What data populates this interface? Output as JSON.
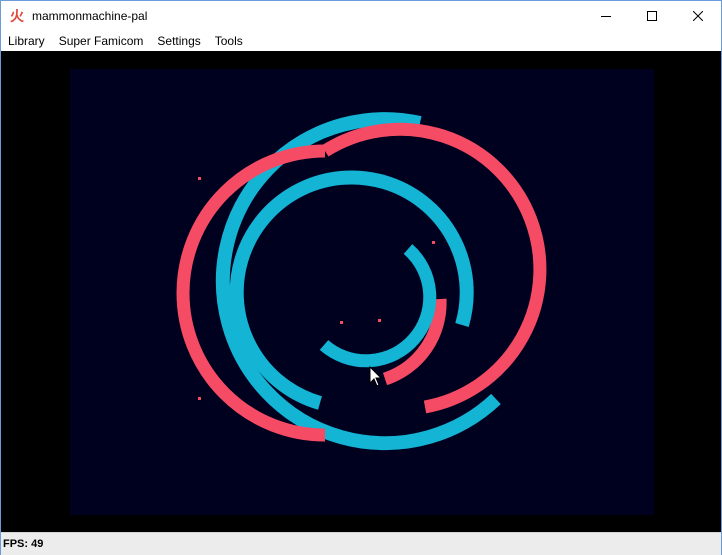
{
  "window": {
    "title": "mammonmachine-pal",
    "app_icon_glyph": "火"
  },
  "menubar": {
    "items": [
      "Library",
      "Super Famicom",
      "Settings",
      "Tools"
    ]
  },
  "statusbar": {
    "fps_text": "FPS: 49"
  },
  "colors": {
    "screen_bg": "#00001f",
    "ring_cyan": "#13b4d4",
    "ring_red": "#f54b64",
    "viewport_bg": "#000000"
  },
  "icons": {
    "app": "fire-kanji-icon",
    "minimize": "minimize-icon",
    "maximize": "maximize-icon",
    "close": "close-icon",
    "cursor": "mouse-cursor-icon"
  }
}
